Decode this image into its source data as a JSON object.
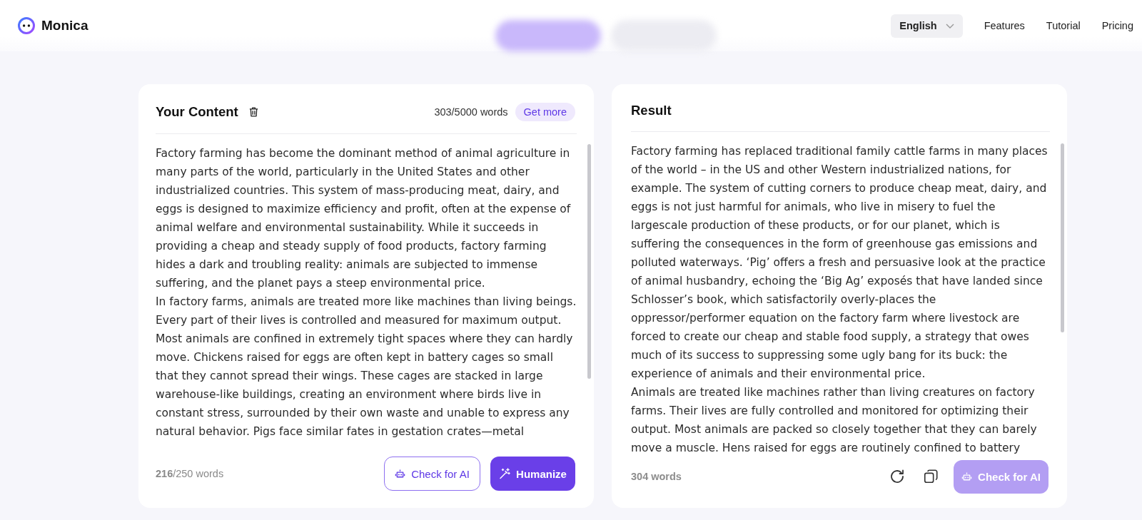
{
  "header": {
    "brand": "Monica",
    "mode_tabs": [
      {
        "selected": true
      },
      {
        "selected": false
      }
    ],
    "language": {
      "label": "English"
    },
    "nav": [
      {
        "label": "Features"
      },
      {
        "label": "Tutorial"
      },
      {
        "label": "Pricing"
      }
    ]
  },
  "input_panel": {
    "title": "Your Content",
    "word_quota": "303/5000 words",
    "get_more": "Get more",
    "paragraphs": [
      "Factory farming has become the dominant method of animal agriculture in many parts of the world, particularly in the United States and other industrialized countries. This system of mass-producing meat, dairy, and eggs is designed to maximize efficiency and profit, often at the expense of animal welfare and environmental sustainability. While it succeeds in providing a cheap and steady supply of food products, factory farming hides a dark and troubling reality: animals are subjected to immense suffering, and the planet pays a steep environmental price.",
      "In factory farms, animals are treated more like machines than living beings. Every part of their lives is controlled and measured for maximum output. Most animals are confined in extremely tight spaces where they can hardly move. Chickens raised for eggs are often kept in battery cages so small that they cannot spread their wings. These cages are stacked in large warehouse-like buildings, creating an environment where birds live in constant stress, surrounded by their own waste and unable to express any natural behavior. Pigs face similar fates in gestation crates—metal"
    ],
    "word_count": "**216**/250 words",
    "buttons": [
      {
        "kind": "outline",
        "label": "Check for AI"
      },
      {
        "kind": "primary",
        "label": "Humanize"
      }
    ]
  },
  "result_panel": {
    "title": "Result",
    "paragraphs": [
      "Factory farming has replaced traditional family cattle farms in many places of the world – in the US and other Western industrialized nations, for example. The system of cutting corners to produce cheap meat, dairy, and eggs is not just harmful for animals, who live in misery to fuel the largescale production of these products, or for our planet, which is suffering the consequences in the form of greenhouse gas emissions and polluted waterways. ‘Pig’ offers a fresh and persuasive look at the practice of animal husbandry, echoing the ‘Big Ag’ exposés that have landed since Schlosser’s book, which satisfactorily overly-places the oppressor/performer equation on the factory farm where livestock are forced to create our cheap and stable food supply, a strategy that owes much of its success to suppressing some ugly bang for its buck: the experience of animals and their environmental price.",
      "Animals are treated like machines rather than living creatures on factory farms. Their lives are fully controlled and monitored for optimizing their output. Most animals are packed so closely together that they can barely move a muscle. Hens raised for eggs are routinely confined to battery"
    ],
    "word_count": "304 words",
    "check_button": {
      "label": "Check for AI",
      "disabled": true
    }
  }
}
